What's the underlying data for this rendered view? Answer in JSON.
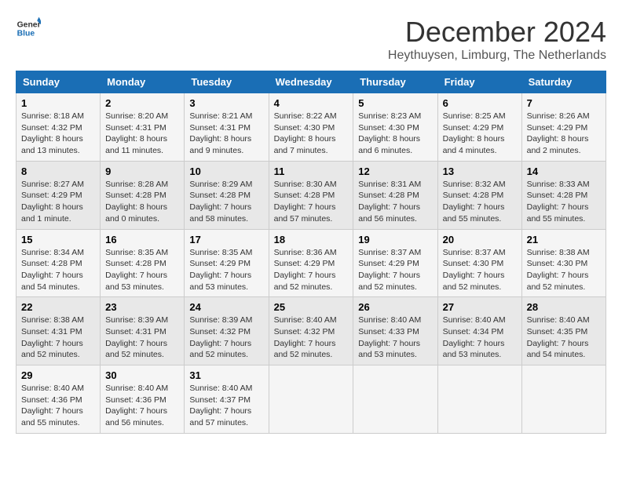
{
  "header": {
    "logo_line1": "General",
    "logo_line2": "Blue",
    "month": "December 2024",
    "location": "Heythuysen, Limburg, The Netherlands"
  },
  "days_of_week": [
    "Sunday",
    "Monday",
    "Tuesday",
    "Wednesday",
    "Thursday",
    "Friday",
    "Saturday"
  ],
  "weeks": [
    [
      {
        "day": "1",
        "sunrise": "8:18 AM",
        "sunset": "4:32 PM",
        "daylight": "8 hours and 13 minutes."
      },
      {
        "day": "2",
        "sunrise": "8:20 AM",
        "sunset": "4:31 PM",
        "daylight": "8 hours and 11 minutes."
      },
      {
        "day": "3",
        "sunrise": "8:21 AM",
        "sunset": "4:31 PM",
        "daylight": "8 hours and 9 minutes."
      },
      {
        "day": "4",
        "sunrise": "8:22 AM",
        "sunset": "4:30 PM",
        "daylight": "8 hours and 7 minutes."
      },
      {
        "day": "5",
        "sunrise": "8:23 AM",
        "sunset": "4:30 PM",
        "daylight": "8 hours and 6 minutes."
      },
      {
        "day": "6",
        "sunrise": "8:25 AM",
        "sunset": "4:29 PM",
        "daylight": "8 hours and 4 minutes."
      },
      {
        "day": "7",
        "sunrise": "8:26 AM",
        "sunset": "4:29 PM",
        "daylight": "8 hours and 2 minutes."
      }
    ],
    [
      {
        "day": "8",
        "sunrise": "8:27 AM",
        "sunset": "4:29 PM",
        "daylight": "8 hours and 1 minute."
      },
      {
        "day": "9",
        "sunrise": "8:28 AM",
        "sunset": "4:28 PM",
        "daylight": "8 hours and 0 minutes."
      },
      {
        "day": "10",
        "sunrise": "8:29 AM",
        "sunset": "4:28 PM",
        "daylight": "7 hours and 58 minutes."
      },
      {
        "day": "11",
        "sunrise": "8:30 AM",
        "sunset": "4:28 PM",
        "daylight": "7 hours and 57 minutes."
      },
      {
        "day": "12",
        "sunrise": "8:31 AM",
        "sunset": "4:28 PM",
        "daylight": "7 hours and 56 minutes."
      },
      {
        "day": "13",
        "sunrise": "8:32 AM",
        "sunset": "4:28 PM",
        "daylight": "7 hours and 55 minutes."
      },
      {
        "day": "14",
        "sunrise": "8:33 AM",
        "sunset": "4:28 PM",
        "daylight": "7 hours and 55 minutes."
      }
    ],
    [
      {
        "day": "15",
        "sunrise": "8:34 AM",
        "sunset": "4:28 PM",
        "daylight": "7 hours and 54 minutes."
      },
      {
        "day": "16",
        "sunrise": "8:35 AM",
        "sunset": "4:28 PM",
        "daylight": "7 hours and 53 minutes."
      },
      {
        "day": "17",
        "sunrise": "8:35 AM",
        "sunset": "4:29 PM",
        "daylight": "7 hours and 53 minutes."
      },
      {
        "day": "18",
        "sunrise": "8:36 AM",
        "sunset": "4:29 PM",
        "daylight": "7 hours and 52 minutes."
      },
      {
        "day": "19",
        "sunrise": "8:37 AM",
        "sunset": "4:29 PM",
        "daylight": "7 hours and 52 minutes."
      },
      {
        "day": "20",
        "sunrise": "8:37 AM",
        "sunset": "4:30 PM",
        "daylight": "7 hours and 52 minutes."
      },
      {
        "day": "21",
        "sunrise": "8:38 AM",
        "sunset": "4:30 PM",
        "daylight": "7 hours and 52 minutes."
      }
    ],
    [
      {
        "day": "22",
        "sunrise": "8:38 AM",
        "sunset": "4:31 PM",
        "daylight": "7 hours and 52 minutes."
      },
      {
        "day": "23",
        "sunrise": "8:39 AM",
        "sunset": "4:31 PM",
        "daylight": "7 hours and 52 minutes."
      },
      {
        "day": "24",
        "sunrise": "8:39 AM",
        "sunset": "4:32 PM",
        "daylight": "7 hours and 52 minutes."
      },
      {
        "day": "25",
        "sunrise": "8:40 AM",
        "sunset": "4:32 PM",
        "daylight": "7 hours and 52 minutes."
      },
      {
        "day": "26",
        "sunrise": "8:40 AM",
        "sunset": "4:33 PM",
        "daylight": "7 hours and 53 minutes."
      },
      {
        "day": "27",
        "sunrise": "8:40 AM",
        "sunset": "4:34 PM",
        "daylight": "7 hours and 53 minutes."
      },
      {
        "day": "28",
        "sunrise": "8:40 AM",
        "sunset": "4:35 PM",
        "daylight": "7 hours and 54 minutes."
      }
    ],
    [
      {
        "day": "29",
        "sunrise": "8:40 AM",
        "sunset": "4:36 PM",
        "daylight": "7 hours and 55 minutes."
      },
      {
        "day": "30",
        "sunrise": "8:40 AM",
        "sunset": "4:36 PM",
        "daylight": "7 hours and 56 minutes."
      },
      {
        "day": "31",
        "sunrise": "8:40 AM",
        "sunset": "4:37 PM",
        "daylight": "7 hours and 57 minutes."
      },
      null,
      null,
      null,
      null
    ]
  ],
  "labels": {
    "sunrise_prefix": "Sunrise: ",
    "sunset_prefix": "Sunset: ",
    "daylight_prefix": "Daylight: "
  }
}
